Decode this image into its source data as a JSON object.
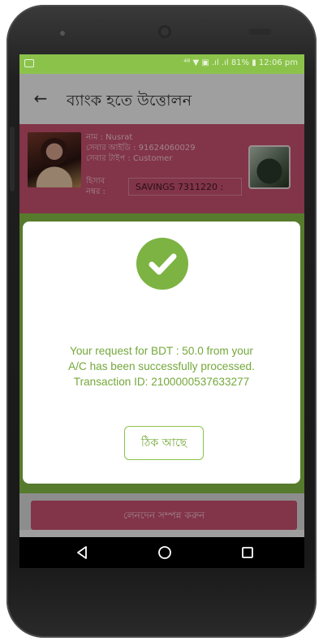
{
  "status_bar": {
    "text": "⁴⁸ ▼ ▣ .ıl .ıl 81% ▮ 12:06 pm"
  },
  "app_bar": {
    "title": "ব্যাংক হতে উত্তোলন",
    "back_icon": "arrow-left-icon"
  },
  "customer": {
    "name_line": "নাম : Nusrat",
    "id_line": "সেবার আইডি : 91624060029",
    "type_line": "সেবার টাইপ : Customer",
    "account_label_1": "হিসাব",
    "account_label_2": "নম্বর :",
    "account_value": "SAVINGS 7311220 :"
  },
  "dialog": {
    "icon": "check-circle-icon",
    "message_line1": "Your  request for BDT : 50.0 from your",
    "message_line2": "A/C  has been successfully processed.",
    "message_line3": "Transaction ID: 2100000537633277",
    "ok_label": "ঠিক আছে"
  },
  "footer": {
    "submit_label": "লেনদেন সম্পন্ন করুন"
  },
  "colors": {
    "status_bar": "#8bc34a",
    "card": "#c8506f",
    "success_green": "#7cb342",
    "dialog_text": "#74a83a"
  }
}
